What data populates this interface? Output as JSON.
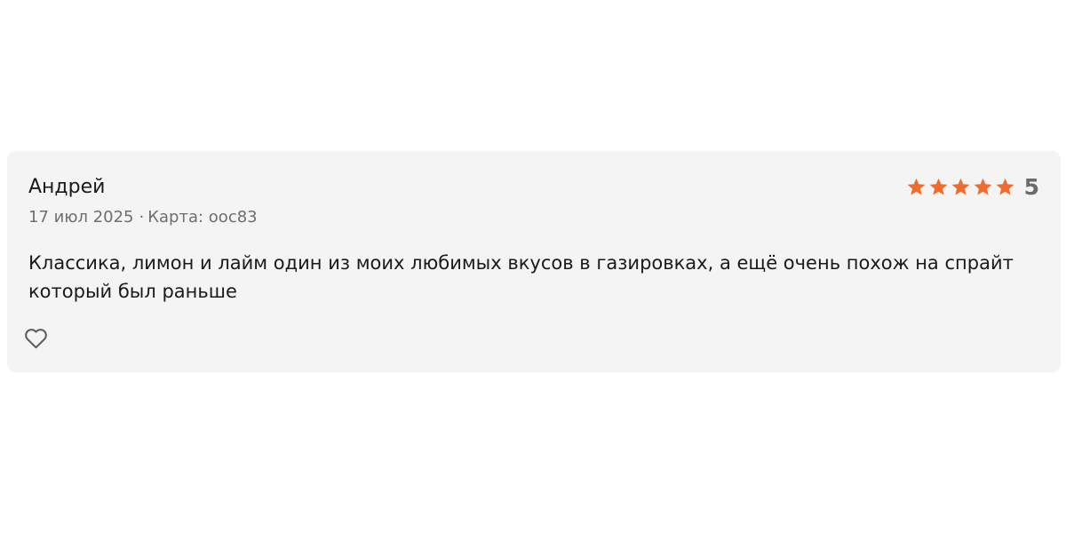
{
  "review": {
    "author": "Андрей",
    "date": "17 июл 2025",
    "separator": "·",
    "card_label": "Карта: ",
    "card_number": " ooc83",
    "rating": {
      "value": 5,
      "value_label": "5",
      "max": 5,
      "star_color": "#f26a2e"
    },
    "text": "Классика, лимон и лайм один из моих любимых вкусов в газировках, а ещё очень похож на спрайт который был раньше"
  },
  "icons": {
    "star": "star-icon",
    "like": "heart-outline-icon"
  }
}
